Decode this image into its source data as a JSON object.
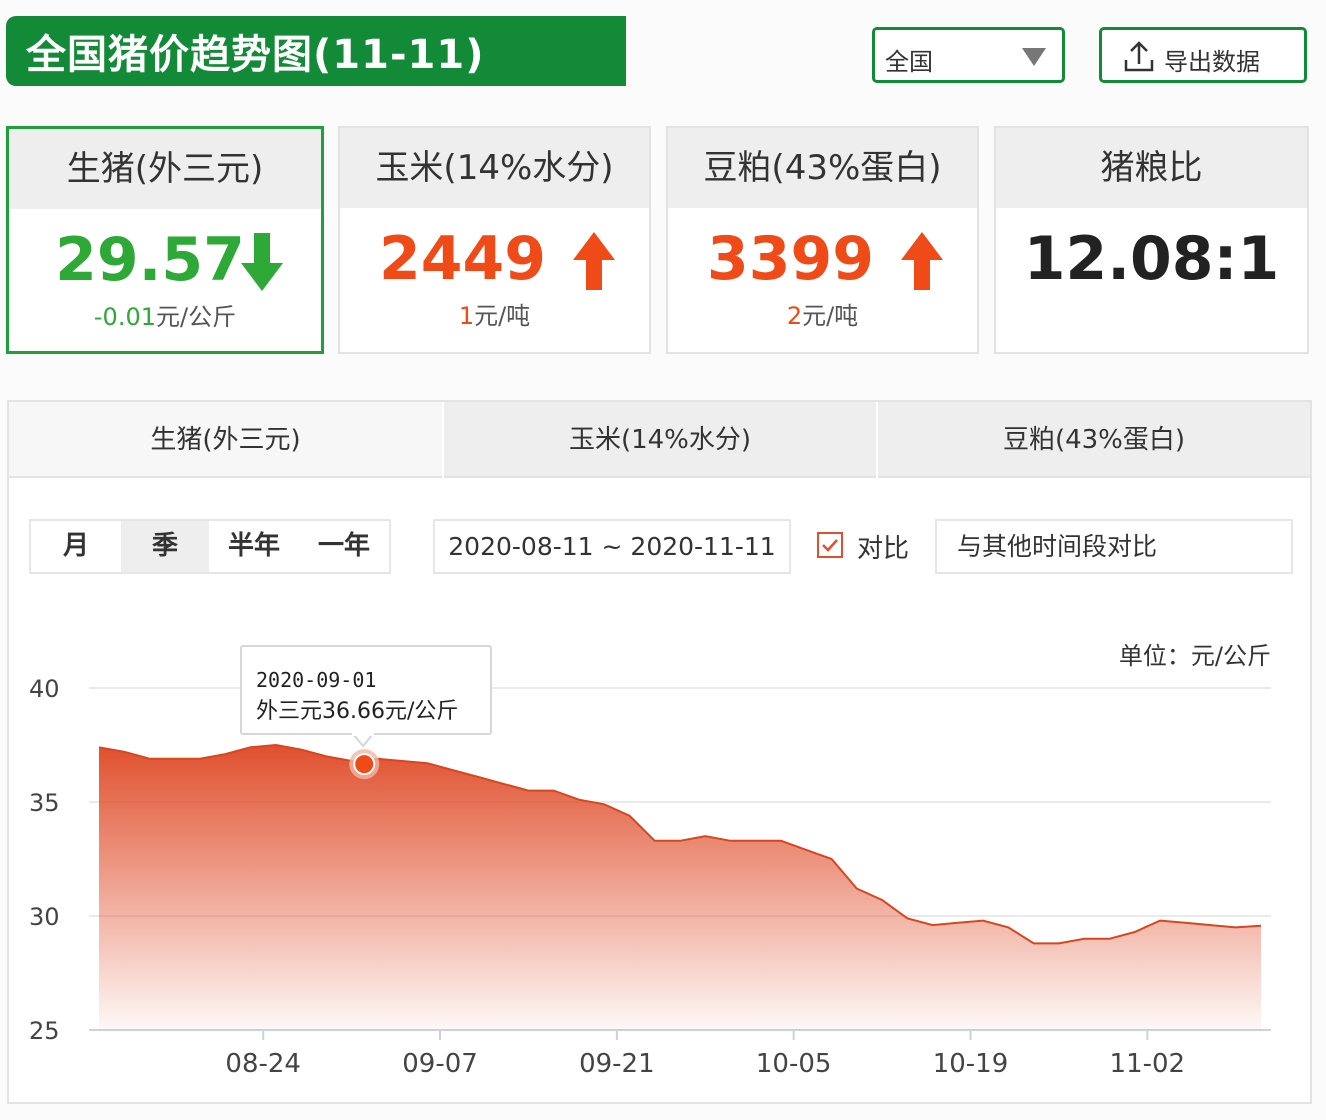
{
  "header": {
    "title": "全国猪价趋势图(11-11)",
    "region_value": "全国",
    "export_label": "导出数据"
  },
  "cards": [
    {
      "name": "生猪(外三元)",
      "value": "29.57",
      "delta_num": "-0.01",
      "delta_unit": "元/公斤",
      "trend": "down",
      "color": "#2ea836"
    },
    {
      "name": "玉米(14%水分)",
      "value": "2449",
      "delta_num": "1",
      "delta_unit": "元/吨",
      "trend": "up",
      "color": "#f04a18"
    },
    {
      "name": "豆粕(43%蛋白)",
      "value": "3399",
      "delta_num": "2",
      "delta_unit": "元/吨",
      "trend": "up",
      "color": "#f04a18"
    },
    {
      "name": "猪粮比",
      "value": "12.08:1",
      "color": "#222222"
    }
  ],
  "tabs": [
    "生猪(外三元)",
    "玉米(14%水分)",
    "豆粕(43%蛋白)"
  ],
  "range_buttons": [
    "月",
    "季",
    "半年",
    "一年"
  ],
  "date_range": "2020-08-11 ~ 2020-11-11",
  "compare_label": "对比",
  "compare_placeholder": "与其他时间段对比",
  "unit_label": "单位：元/公斤",
  "tooltip": {
    "date": "2020-09-01",
    "text": "外三元36.66元/公斤"
  },
  "colors": {
    "brand_green": "#138a37",
    "up_red": "#f04a18",
    "down_green": "#2ea836",
    "area": "#e0502e"
  },
  "chart_data": {
    "type": "area",
    "ylim": [
      25,
      40
    ],
    "yticks": [
      25,
      30,
      35,
      40
    ],
    "xticks": [
      "08-24",
      "09-07",
      "09-21",
      "10-05",
      "10-19",
      "11-02"
    ],
    "x": [
      "08-11",
      "08-13",
      "08-15",
      "08-17",
      "08-19",
      "08-21",
      "08-23",
      "08-25",
      "08-27",
      "08-29",
      "08-31",
      "09-01",
      "09-02",
      "09-04",
      "09-06",
      "09-08",
      "09-10",
      "09-12",
      "09-14",
      "09-16",
      "09-18",
      "09-20",
      "09-22",
      "09-24",
      "09-26",
      "09-28",
      "09-30",
      "10-02",
      "10-04",
      "10-06",
      "10-08",
      "10-10",
      "10-12",
      "10-14",
      "10-16",
      "10-18",
      "10-20",
      "10-22",
      "10-24",
      "10-26",
      "10-28",
      "10-30",
      "11-01",
      "11-03",
      "11-05",
      "11-07",
      "11-09",
      "11-11"
    ],
    "values": [
      37.4,
      37.2,
      36.9,
      36.9,
      36.9,
      37.1,
      37.4,
      37.5,
      37.3,
      37.0,
      36.8,
      36.66,
      36.9,
      36.8,
      36.7,
      36.4,
      36.1,
      35.8,
      35.5,
      35.5,
      35.1,
      34.9,
      34.4,
      33.3,
      33.3,
      33.5,
      33.3,
      33.3,
      33.3,
      32.9,
      32.5,
      31.2,
      30.7,
      29.9,
      29.6,
      29.7,
      29.8,
      29.5,
      28.8,
      28.8,
      29.0,
      29.0,
      29.3,
      29.8,
      29.7,
      29.6,
      29.5,
      29.57
    ],
    "highlight": {
      "x": "09-01",
      "value": 36.66
    }
  }
}
